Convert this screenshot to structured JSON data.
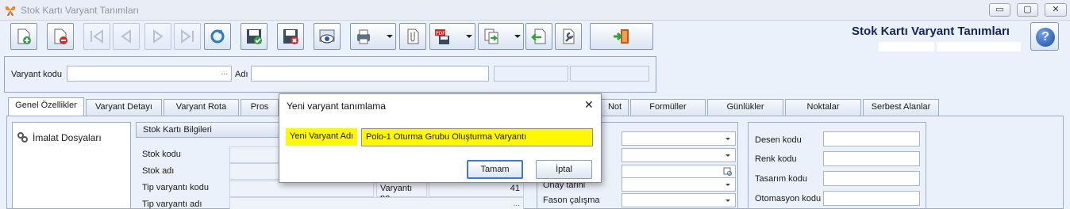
{
  "window": {
    "title": "Stok Kartı Varyant Tanımları",
    "controls": {
      "minimize": "▭",
      "maximize": "▢",
      "close": "✕"
    }
  },
  "toolbar": {
    "buttons": [
      {
        "icon": "new-record-icon",
        "enabled": true
      },
      {
        "icon": "delete-record-icon",
        "enabled": true
      },
      {
        "icon": "first-record-icon",
        "enabled": false
      },
      {
        "icon": "previous-record-icon",
        "enabled": false
      },
      {
        "icon": "next-record-icon",
        "enabled": false
      },
      {
        "icon": "last-record-icon",
        "enabled": false
      },
      {
        "icon": "refresh-icon",
        "enabled": true
      },
      {
        "icon": "save-icon",
        "enabled": true
      },
      {
        "icon": "cancel-save-icon",
        "enabled": true
      },
      {
        "icon": "preview-icon",
        "enabled": true
      },
      {
        "icon": "print-icon",
        "enabled": true
      },
      {
        "icon": "attachment-icon",
        "enabled": true
      },
      {
        "icon": "pdf-export-icon",
        "enabled": true
      },
      {
        "icon": "transfer-icon",
        "enabled": true
      },
      {
        "icon": "import-icon",
        "enabled": true
      },
      {
        "icon": "settings-wrench-icon",
        "enabled": true
      },
      {
        "icon": "exit-door-icon",
        "enabled": true
      }
    ]
  },
  "header": {
    "page_title": "Stok Kartı Varyant Tanımları",
    "help": "?"
  },
  "search": {
    "variant_code_label": "Varyant kodu",
    "variant_code_value": "",
    "name_label": "Adı",
    "name_value": "",
    "lookup_dots": "..."
  },
  "tabs": [
    {
      "label": "Genel Özellikler",
      "active": true
    },
    {
      "label": "Varyant Detayı",
      "active": false
    },
    {
      "label": "Varyant Rota",
      "active": false
    },
    {
      "label": "Pros",
      "active": false
    },
    {
      "label": "Not",
      "active": false
    },
    {
      "label": "Formüller",
      "active": false
    },
    {
      "label": "Günlükler",
      "active": false
    },
    {
      "label": "Noktalar",
      "active": false
    },
    {
      "label": "Serbest Alanlar",
      "active": false
    }
  ],
  "tree": {
    "items": [
      {
        "label": "İmalat Dosyaları"
      }
    ]
  },
  "stock_group": {
    "title": "Stok Kartı Bilgileri",
    "fields": [
      {
        "label": "Stok kodu",
        "value": ""
      },
      {
        "label": "Stok adı",
        "value": ""
      },
      {
        "label": "Tip varyantı kodu",
        "value": ""
      },
      {
        "label": "Tip varyantı adı",
        "value": ""
      }
    ],
    "variant_no_label": "Varyantı no",
    "variant_no_value": "41",
    "lookup_dots": "..."
  },
  "mid_fields": [
    {
      "label": "",
      "value": ""
    },
    {
      "label": "",
      "value": ""
    },
    {
      "label": "",
      "value": ""
    },
    {
      "label": "Onay tarihi",
      "value": ""
    },
    {
      "label": "Fason çalışma",
      "value": ""
    }
  ],
  "right_fields": [
    {
      "label": "Desen kodu",
      "value": ""
    },
    {
      "label": "Renk kodu",
      "value": ""
    },
    {
      "label": "Tasarım kodu",
      "value": ""
    },
    {
      "label": "Otomasyon kodu",
      "value": ""
    }
  ],
  "dialog": {
    "title": "Yeni varyant tanımlama",
    "close": "✕",
    "field_label": "Yeni Varyant Adı",
    "field_value": "Polo-1 Oturma Grubu Oluşturma Varyantı",
    "ok_label": "Tamam",
    "cancel_label": "İptal",
    "highlight_color": "#fff800"
  },
  "colors": {
    "accent": "#13245a",
    "panel": "#eaf1fb",
    "border": "#9aaecb"
  }
}
